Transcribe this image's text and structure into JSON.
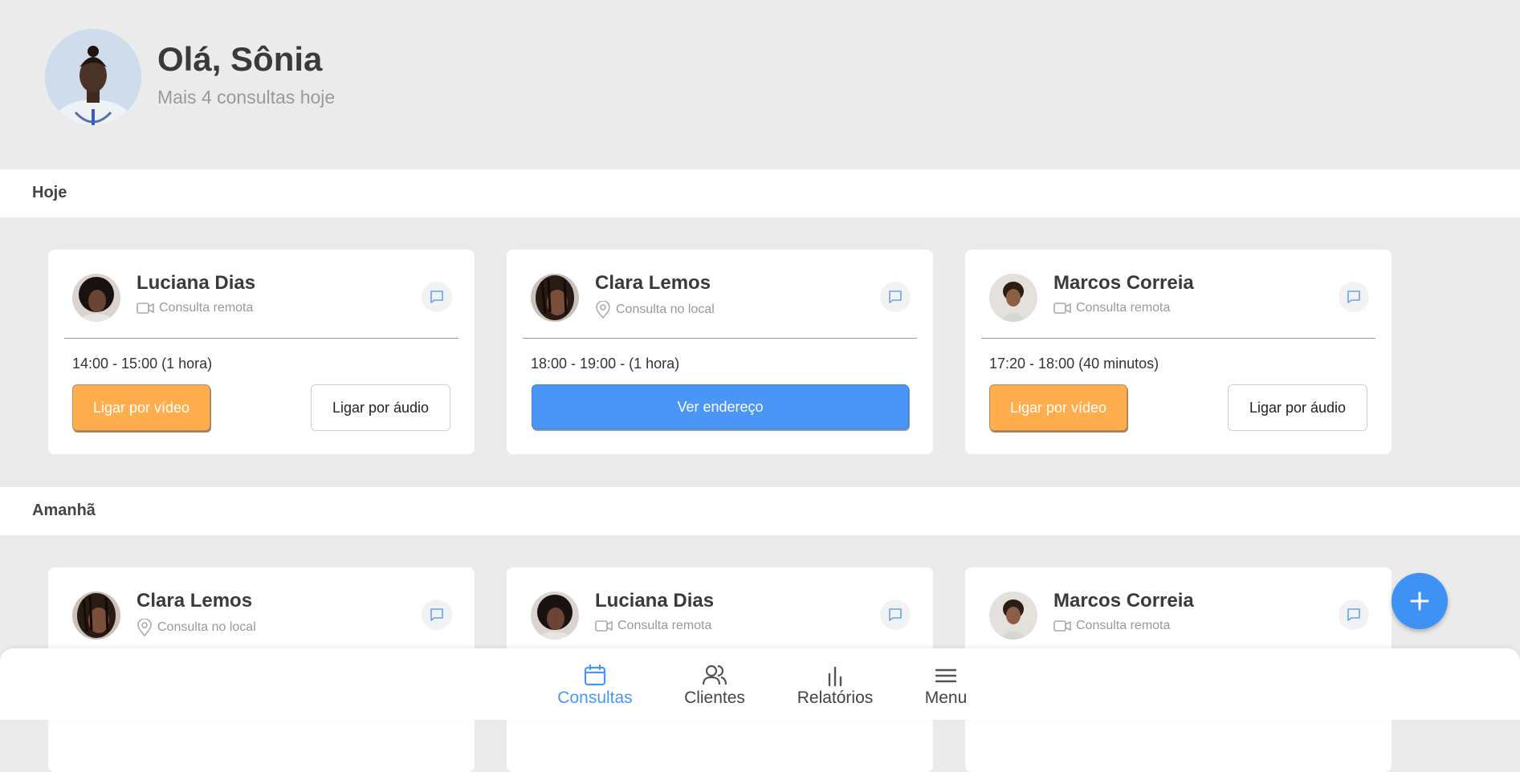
{
  "user": {
    "greeting": "Olá, Sônia",
    "subtitle": "Mais 4 consultas hoje"
  },
  "sections": {
    "today": "Hoje",
    "tomorrow": "Amanhã"
  },
  "today_cards": [
    {
      "name": "Luciana Dias",
      "type": "Consulta remota",
      "type_icon": "video-icon",
      "time": "14:00 - 15:00 (1 hora)",
      "video_button": "Ligar por vídeo",
      "audio_button": "Ligar por áudio"
    },
    {
      "name": "Clara Lemos",
      "type": "Consulta no local",
      "type_icon": "location-pin-icon",
      "time": "18:00 - 19:00 - (1 hora)",
      "address_button": "Ver endereço"
    },
    {
      "name": "Marcos Correia",
      "type": "Consulta remota",
      "type_icon": "video-icon",
      "time": "17:20 - 18:00 (40 minutos)",
      "video_button": "Ligar por vídeo",
      "audio_button": "Ligar por áudio"
    }
  ],
  "tomorrow_cards": [
    {
      "name": "Clara Lemos",
      "type": "Consulta no local",
      "type_icon": "location-pin-icon"
    },
    {
      "name": "Luciana Dias",
      "type": "Consulta remota",
      "type_icon": "video-icon"
    },
    {
      "name": "Marcos Correia",
      "type": "Consulta remota",
      "type_icon": "video-icon"
    }
  ],
  "fab": {
    "icon": "plus-icon"
  },
  "nav": {
    "consultas": "Consultas",
    "clientes": "Clientes",
    "relatorios": "Relatórios",
    "menu": "Menu"
  },
  "colors": {
    "accent": "#4a96f7",
    "video_button": "#ffad4d",
    "background": "#ebebec"
  }
}
